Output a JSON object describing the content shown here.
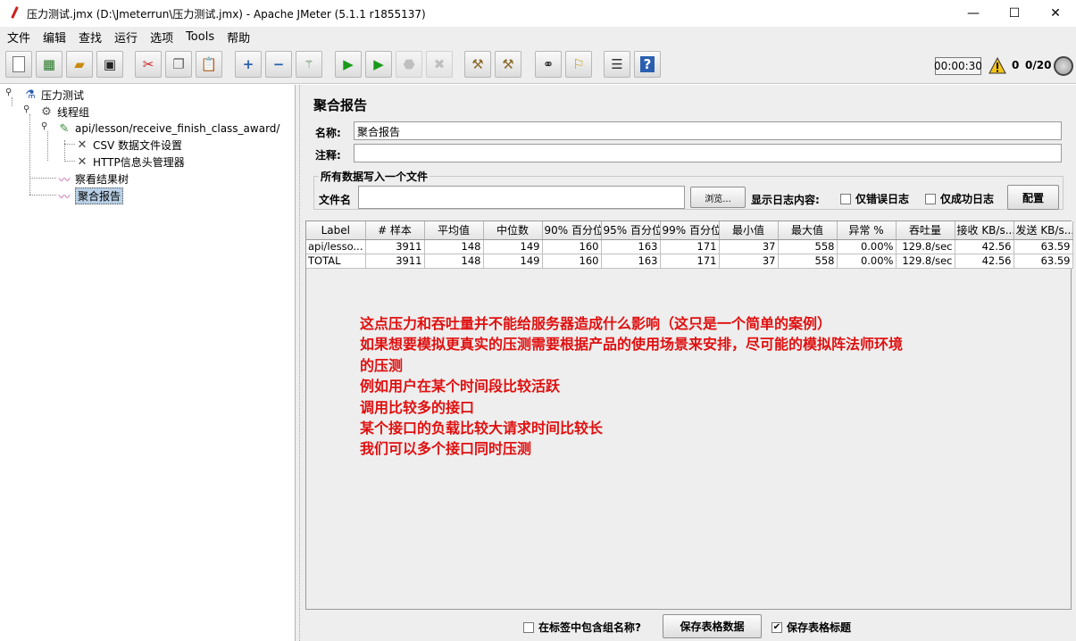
{
  "window": {
    "title": "压力测试.jmx (D:\\Jmeterrun\\压力测试.jmx) - Apache JMeter (5.1.1 r1855137)",
    "minimize": "—",
    "maximize": "☐",
    "close": "✕"
  },
  "menu": [
    "文件",
    "编辑",
    "查找",
    "运行",
    "选项",
    "Tools",
    "帮助"
  ],
  "toolbar": {
    "timer": "00:00:30",
    "warnings": "0",
    "threads": "0/20",
    "icons": [
      "new-icon",
      "templates-icon",
      "open-icon",
      "save-icon",
      "cut-icon",
      "copy-icon",
      "paste-icon",
      "expand-icon",
      "collapse-icon",
      "toggle-icon",
      "start-icon",
      "start-no-pause-icon",
      "stop-icon",
      "shutdown-icon",
      "clear-icon",
      "clear-all-icon",
      "search-icon",
      "reset-search-icon",
      "function-helper-icon",
      "help-icon"
    ]
  },
  "tree": {
    "items": [
      {
        "label": "压力测试",
        "icon": "flask-icon"
      },
      {
        "label": "线程组",
        "icon": "gear-icon"
      },
      {
        "label": "api/lesson/receive_finish_class_award/",
        "icon": "pipette-icon"
      },
      {
        "label": "CSV 数据文件设置",
        "icon": "tools-icon"
      },
      {
        "label": "HTTP信息头管理器",
        "icon": "tools-icon"
      },
      {
        "label": "察看结果树",
        "icon": "chart-icon"
      },
      {
        "label": "聚合报告",
        "icon": "chart-icon"
      }
    ]
  },
  "panel": {
    "title": "聚合报告",
    "name_label": "名称:",
    "name_value": "聚合报告",
    "comment_label": "注释:",
    "comment_value": "",
    "file_group_title": "所有数据写入一个文件",
    "file_label": "文件名",
    "file_value": "",
    "browse_button": "浏览...",
    "log_label": "显示日志内容:",
    "errors_only": "仅错误日志",
    "success_only": "仅成功日志",
    "configure_button": "配置"
  },
  "table": {
    "headers": [
      "Label",
      "# 样本",
      "平均值",
      "中位数",
      "90% 百分位",
      "95% 百分位",
      "99% 百分位",
      "最小值",
      "最大值",
      "异常 %",
      "吞吐量",
      "接收 KB/s...",
      "发送 KB/s..."
    ],
    "rows": [
      [
        "api/lesso...",
        "3911",
        "148",
        "149",
        "160",
        "163",
        "171",
        "37",
        "558",
        "0.00%",
        "129.8/sec",
        "42.56",
        "63.59"
      ],
      [
        "TOTAL",
        "3911",
        "148",
        "149",
        "160",
        "163",
        "171",
        "37",
        "558",
        "0.00%",
        "129.8/sec",
        "42.56",
        "63.59"
      ]
    ]
  },
  "note": {
    "color": "#e01010",
    "lines": [
      "这点压力和吞吐量并不能给服务器造成什么影响（这只是一个简单的案例）",
      "如果想要模拟更真实的压测需要根据产品的使用场景来安排，尽可能的模拟阵法师环境",
      "的压测",
      "例如用户在某个时间段比较活跃",
      "调用比较多的接口",
      "某个接口的负载比较大请求时间比较长",
      "我们可以多个接口同时压测"
    ]
  },
  "bottom": {
    "include_group_label": "在标签中包含组名称?",
    "save_table_data": "保存表格数据",
    "save_table_header": "保存表格标题",
    "save_header_checked": true
  }
}
